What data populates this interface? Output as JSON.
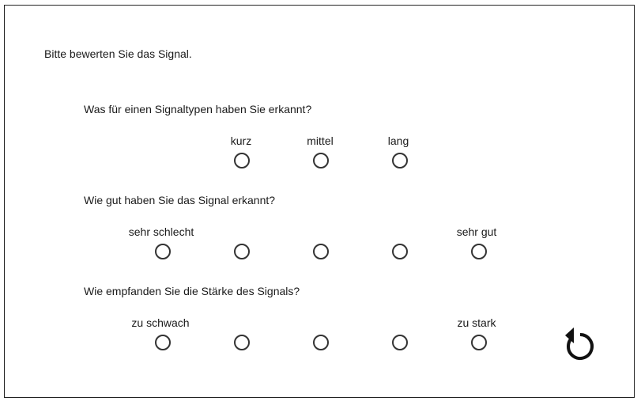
{
  "intro": "Bitte bewerten Sie das Signal.",
  "q1": {
    "question": "Was für einen Signaltypen haben Sie erkannt?",
    "options": [
      "kurz",
      "mittel",
      "lang"
    ]
  },
  "q2": {
    "question": "Wie gut haben Sie das Signal erkannt?",
    "low_label": "sehr schlecht",
    "high_label": "sehr gut"
  },
  "q3": {
    "question": "Wie empfanden Sie die Stärke des Signals?",
    "low_label": "zu schwach",
    "high_label": "zu stark"
  },
  "reset": {
    "icon": "undo-icon"
  }
}
